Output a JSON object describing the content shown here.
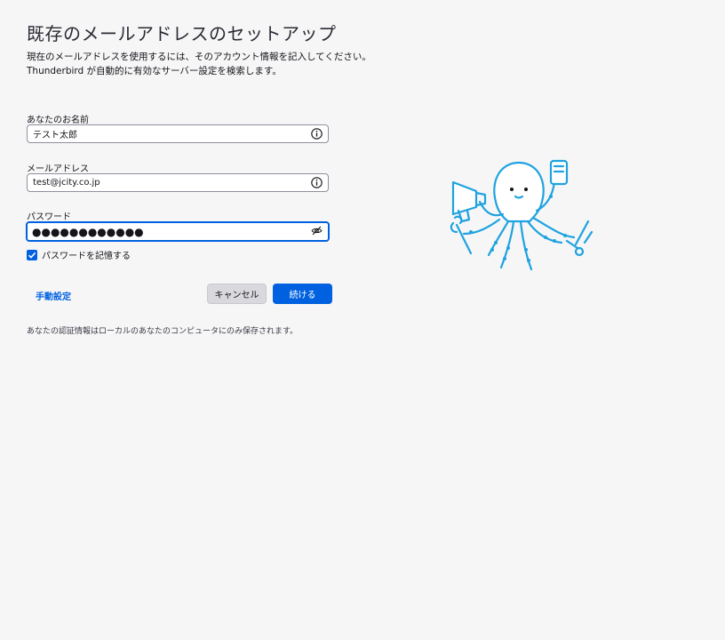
{
  "header": {
    "title": "既存のメールアドレスのセットアップ",
    "intro_line1": "現在のメールアドレスを使用するには、そのアカウント情報を記入してください。",
    "intro_line2": "Thunderbird が自動的に有効なサーバー設定を検索します。"
  },
  "form": {
    "name": {
      "label": "あなたのお名前",
      "value": "テスト太郎",
      "icon": "info-icon"
    },
    "email": {
      "label": "メールアドレス",
      "value": "test@jcity.co.jp",
      "icon": "info-icon"
    },
    "password": {
      "label": "パスワード",
      "value": "●●●●●●●●●●●●",
      "icon": "eye-hidden-icon"
    },
    "remember": {
      "label": "パスワードを記憶する",
      "checked": true
    }
  },
  "actions": {
    "manual_label": "手動設定",
    "cancel_label": "キャンセル",
    "continue_label": "続ける"
  },
  "footnote": "あなたの認証情報はローカルのあなたのコンピュータにのみ保存されます。",
  "colors": {
    "accent": "#0061e0",
    "background": "#f6f6f7",
    "mascot": "#1ea2e0"
  }
}
